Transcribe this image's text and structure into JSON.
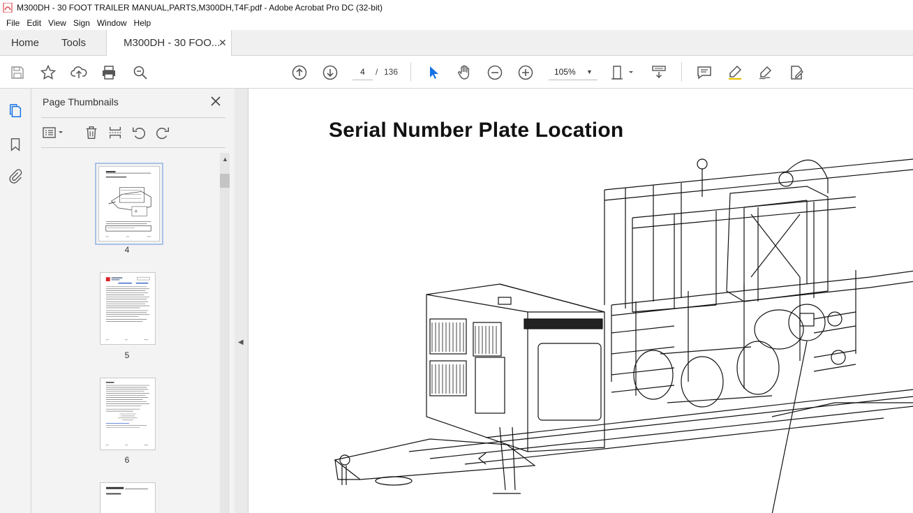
{
  "window": {
    "title": "M300DH - 30 FOOT TRAILER MANUAL,PARTS,M300DH,T4F.pdf - Adobe Acrobat Pro DC (32-bit)"
  },
  "menu": [
    "File",
    "Edit",
    "View",
    "Sign",
    "Window",
    "Help"
  ],
  "tabs": {
    "home": "Home",
    "tools": "Tools",
    "document": "M300DH - 30 FOO..."
  },
  "toolbar": {
    "page_current": "4",
    "page_separator": "/",
    "page_total": "136",
    "zoom": "105%"
  },
  "panel": {
    "title": "Page Thumbnails",
    "thumbnails": [
      {
        "page": "4"
      },
      {
        "page": "5"
      },
      {
        "page": "6"
      }
    ]
  },
  "document": {
    "heading": "Serial Number Plate Location"
  },
  "colors": {
    "accent": "#1473e6",
    "panel_bg": "#f3f3f3",
    "pdf_icon": "#d9252a"
  }
}
